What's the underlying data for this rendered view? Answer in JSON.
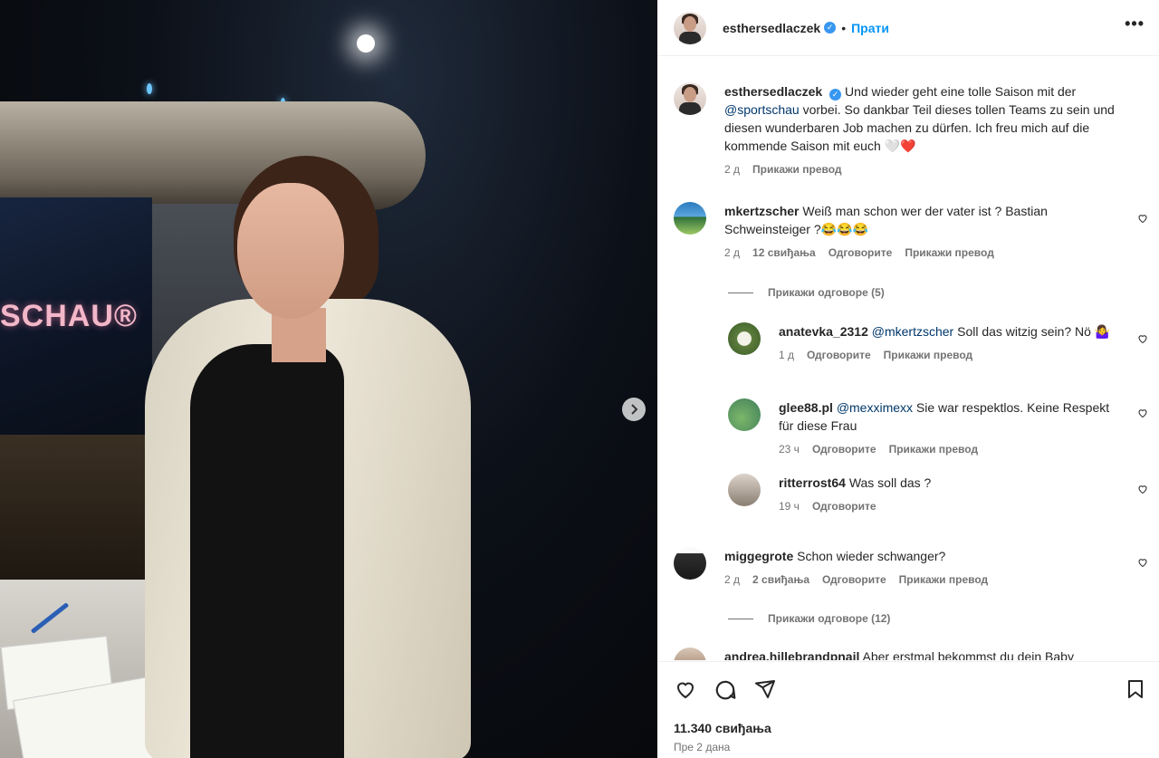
{
  "photo": {
    "studio_sign": "SCHAU®"
  },
  "header": {
    "username": "esthersedlaczek",
    "follow_label": "Прати",
    "separator": "•",
    "more_label": "•••"
  },
  "caption": {
    "username": "esthersedlaczek",
    "text_before": "Und wieder geht eine tolle Saison mit der",
    "mention": "@sportschau",
    "text_after": " vorbei. So dankbar Teil dieses tollen Teams zu sein und diesen wunderbaren Job machen zu dürfen. Ich freu mich auf die kommende Saison mit euch 🤍❤️",
    "time": "2 д",
    "translate": "Прикажи превод"
  },
  "comments": [
    {
      "username": "mkertzscher",
      "text": "Weiß man schon wer der vater ist ? Bastian Schweinsteiger ?😂😂😂",
      "time": "2 д",
      "likes": "12 свиђања",
      "reply": "Одговорите",
      "translate": "Прикажи превод",
      "view_replies": "Прикажи одговоре (5)"
    },
    {
      "username": "miggegrote",
      "text": "Schon wieder schwanger?",
      "time": "2 д",
      "likes": "2 свиђања",
      "reply": "Одговорите",
      "translate": "Прикажи превод",
      "view_replies": "Прикажи одговоре (12)"
    },
    {
      "username": "andrea.hillebrandpnail",
      "text": "Aber erstmal bekommst du dein Baby"
    }
  ],
  "replies": [
    {
      "username": "anatevka_2312",
      "mention": "@mkertzscher",
      "text": " Soll das witzig sein? Nö 🤷‍♀️",
      "time": "1 д",
      "reply": "Одговорите",
      "translate": "Прикажи превод"
    },
    {
      "username": "glee88.pl",
      "mention": "@mexximexx",
      "text": " Sie war respektlos. Keine Respekt für diese Frau",
      "time": "23 ч",
      "reply": "Одговорите",
      "translate": "Прикажи превод"
    },
    {
      "username": "ritterrost64",
      "mention": "",
      "text": "Was soll das ?",
      "time": "19 ч",
      "reply": "Одговорите"
    }
  ],
  "footer": {
    "likes": "11.340 свиђања",
    "date": "Пре 2 дана"
  },
  "icons": {
    "like": "heart-icon",
    "comment": "comment-icon",
    "share": "share-icon",
    "save": "bookmark-icon",
    "next": "chevron-right-icon"
  },
  "colors": {
    "link": "#0095f6",
    "mention": "#00376b",
    "heart": "#ed4956"
  }
}
